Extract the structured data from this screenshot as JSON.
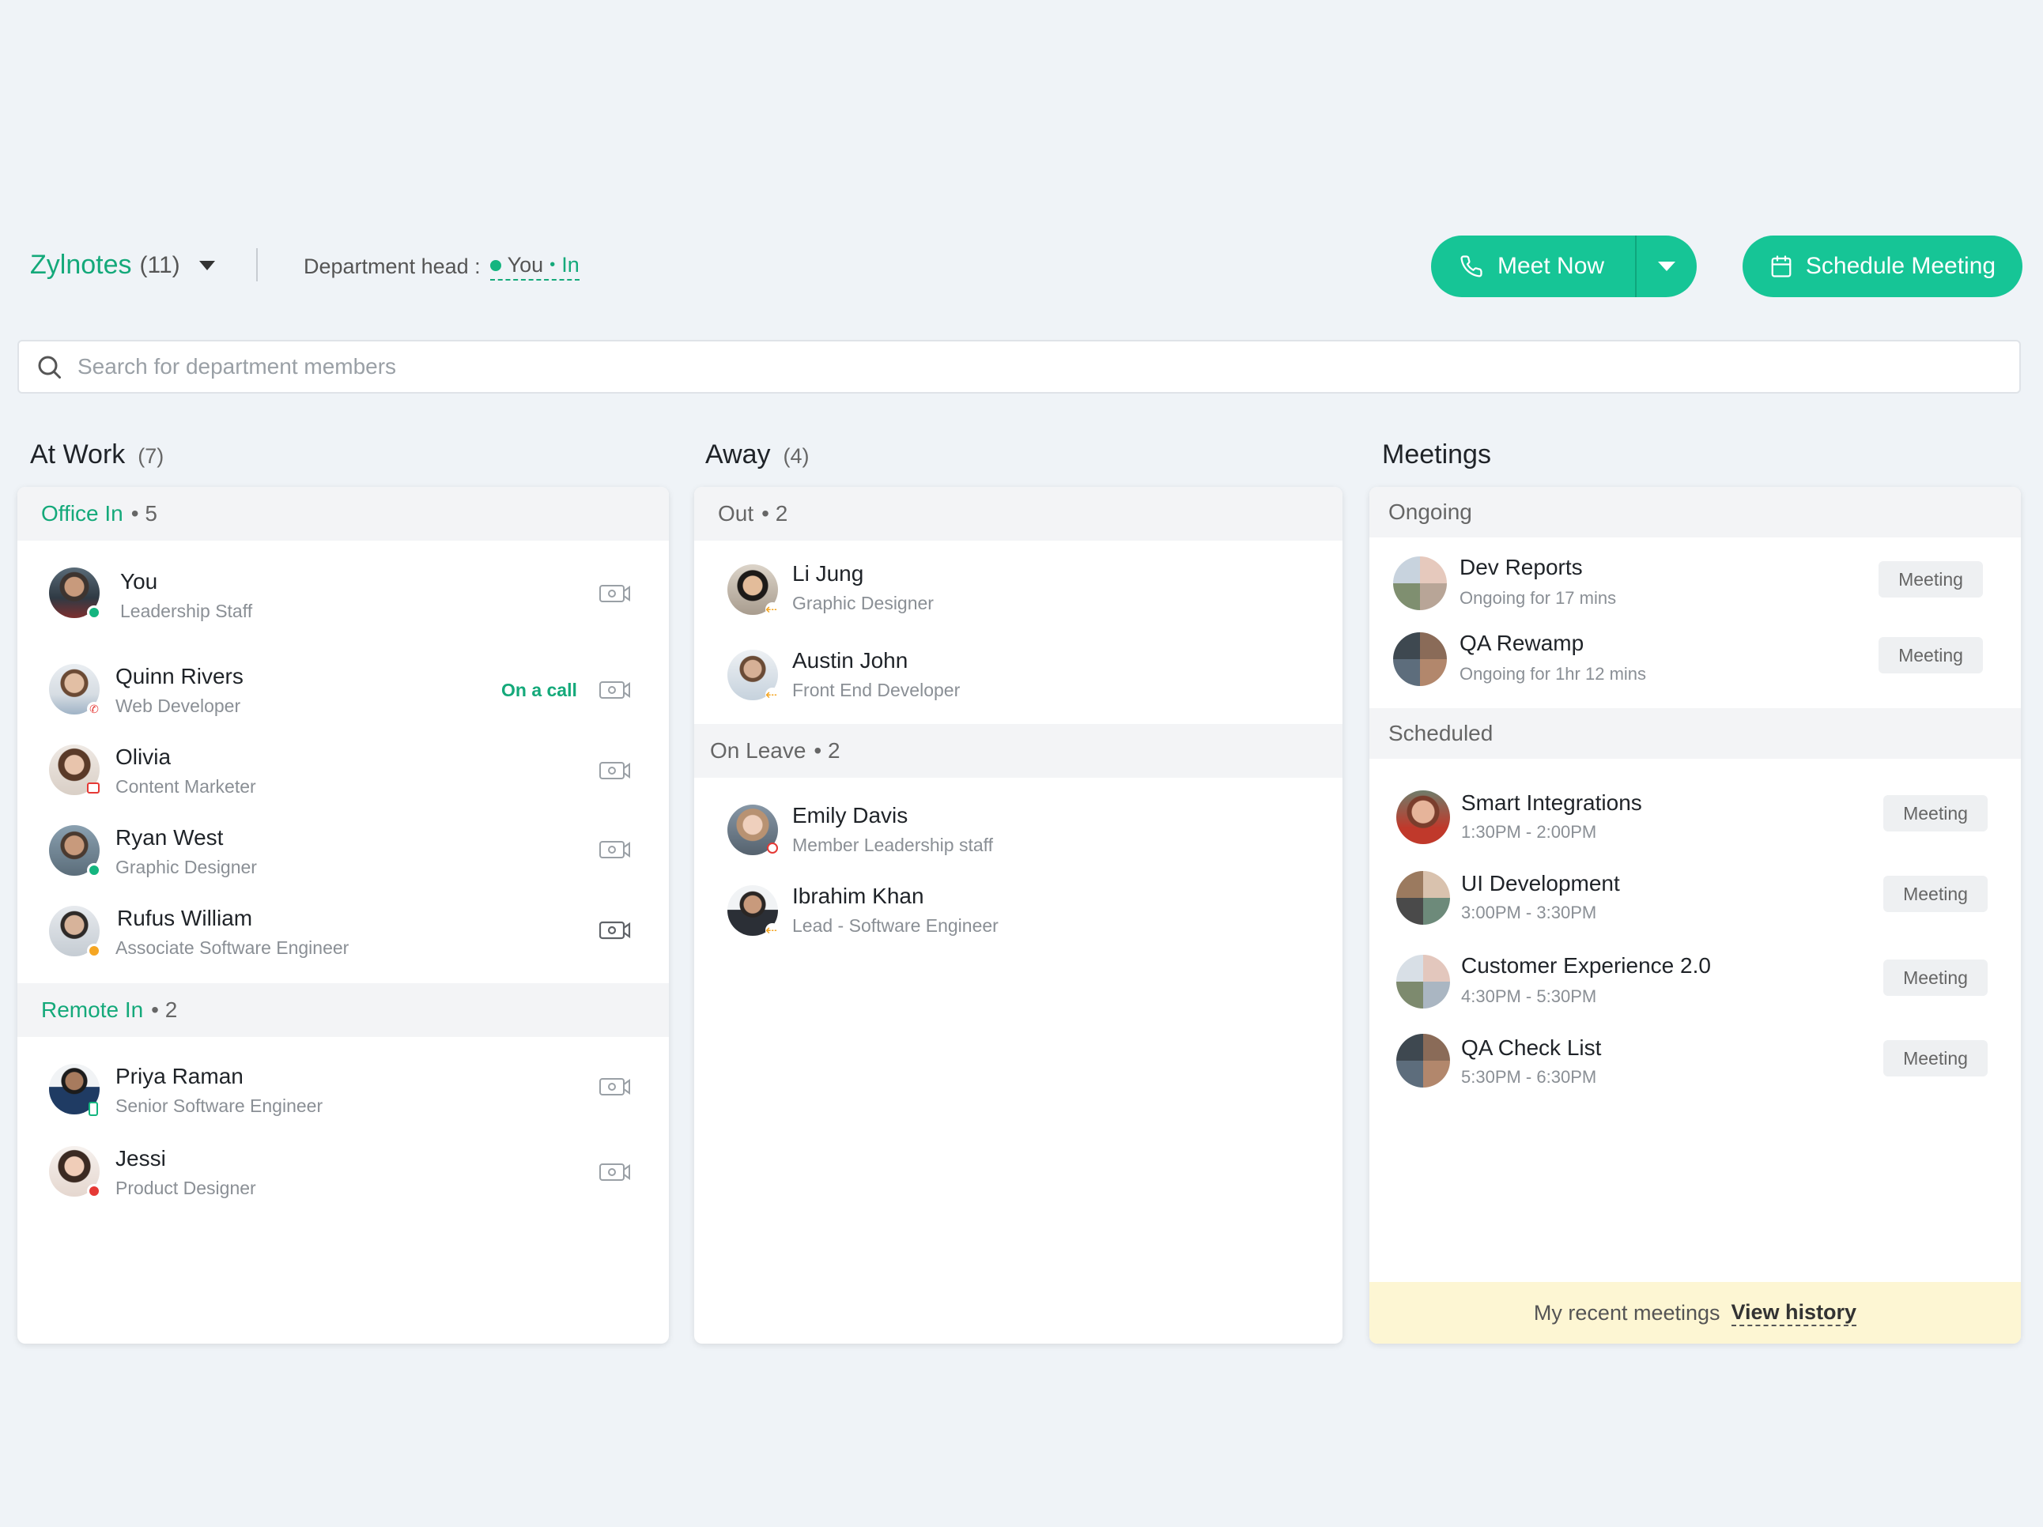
{
  "header": {
    "department_name": "Zylnotes",
    "department_count": "(11)",
    "dept_head_label": "Department head :",
    "dept_head_name": "You",
    "dept_head_separator": "•",
    "dept_head_status": "In",
    "meet_now_label": "Meet Now",
    "schedule_meeting_label": "Schedule Meeting"
  },
  "search": {
    "placeholder": "Search for department members"
  },
  "at_work": {
    "title": "At Work",
    "count": "(7)",
    "groups": [
      {
        "name": "Office In",
        "count": "• 5",
        "members": [
          {
            "name": "You",
            "role": "Leadership Staff",
            "status": "green",
            "on_call": ""
          },
          {
            "name": "Quinn Rivers",
            "role": "Web Developer",
            "status": "call",
            "on_call": "On a call"
          },
          {
            "name": "Olivia",
            "role": "Content Marketer",
            "status": "calendar",
            "on_call": ""
          },
          {
            "name": "Ryan West",
            "role": "Graphic Designer",
            "status": "green",
            "on_call": ""
          },
          {
            "name": "Rufus William",
            "role": "Associate Software Engineer",
            "status": "orange",
            "on_call": ""
          }
        ]
      },
      {
        "name": "Remote In",
        "count": "• 2",
        "members": [
          {
            "name": "Priya Raman",
            "role": "Senior Software Engineer",
            "status": "mobile"
          },
          {
            "name": "Jessi",
            "role": "Product Designer",
            "status": "red"
          }
        ]
      }
    ]
  },
  "away": {
    "title": "Away",
    "count": "(4)",
    "groups": [
      {
        "name": "Out",
        "count": "• 2",
        "members": [
          {
            "name": "Li Jung",
            "role": "Graphic Designer",
            "status": "out"
          },
          {
            "name": "Austin John",
            "role": "Front End Developer",
            "status": "out"
          }
        ]
      },
      {
        "name": "On Leave",
        "count": "• 2",
        "members": [
          {
            "name": "Emily Davis",
            "role": "Member Leadership staff",
            "status": "leave"
          },
          {
            "name": "Ibrahim Khan",
            "role": "Lead - Software Engineer",
            "status": "out"
          }
        ]
      }
    ]
  },
  "meetings": {
    "title": "Meetings",
    "ongoing_label": "Ongoing",
    "scheduled_label": "Scheduled",
    "ongoing": [
      {
        "title": "Dev Reports",
        "time": "Ongoing for 17 mins",
        "badge": "Meeting"
      },
      {
        "title": "QA Rewamp",
        "time": "Ongoing for 1hr 12 mins",
        "badge": "Meeting"
      }
    ],
    "scheduled": [
      {
        "title": "Smart Integrations",
        "time": "1:30PM - 2:00PM",
        "badge": "Meeting"
      },
      {
        "title": "UI Development",
        "time": "3:00PM - 3:30PM",
        "badge": "Meeting"
      },
      {
        "title": "Customer Experience 2.0",
        "time": "4:30PM - 5:30PM",
        "badge": "Meeting"
      },
      {
        "title": "QA Check List",
        "time": "5:30PM - 6:30PM",
        "badge": "Meeting"
      }
    ],
    "footer_text": "My recent meetings",
    "footer_link": "View history"
  },
  "colors": {
    "accent": "#16c596",
    "accent_text": "#14a97a",
    "background": "#eff3f7",
    "status_green": "#14b57f",
    "status_orange": "#f5a623",
    "status_red": "#e53935",
    "footer_bg": "#fdf6d3"
  },
  "icons": {
    "phone": "phone-icon",
    "calendar": "calendar-icon",
    "search": "search-icon",
    "video": "video-icon",
    "caret": "chevron-down-icon"
  }
}
